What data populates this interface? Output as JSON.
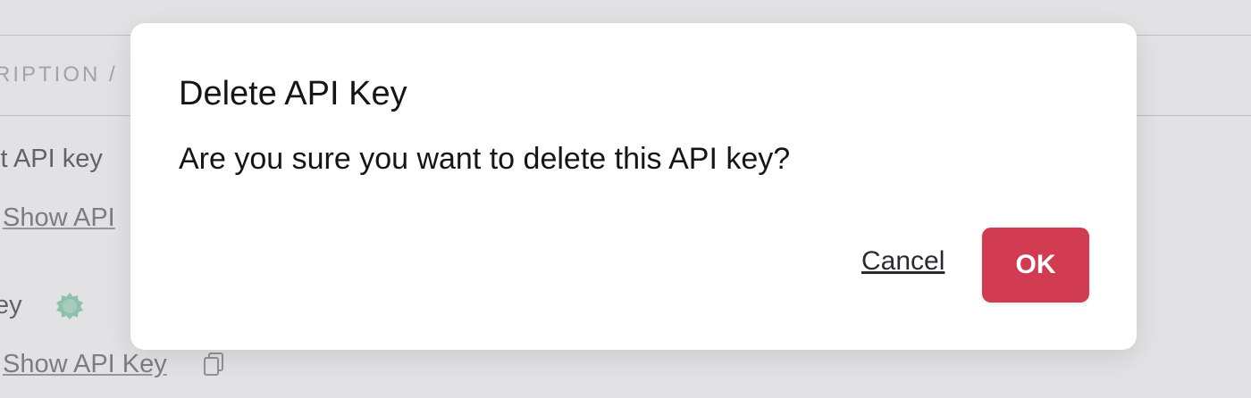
{
  "background": {
    "header_text": "RIPTION /",
    "rows": [
      {
        "label": "lt API key",
        "link": "Show API"
      },
      {
        "label": "ey",
        "link": "Show API Key"
      }
    ],
    "badge_color": "#8fd3b5"
  },
  "dialog": {
    "title": "Delete API Key",
    "message": "Are you sure you want to delete this API key?",
    "cancel_label": "Cancel",
    "ok_label": "OK",
    "ok_color": "#d13c53"
  }
}
